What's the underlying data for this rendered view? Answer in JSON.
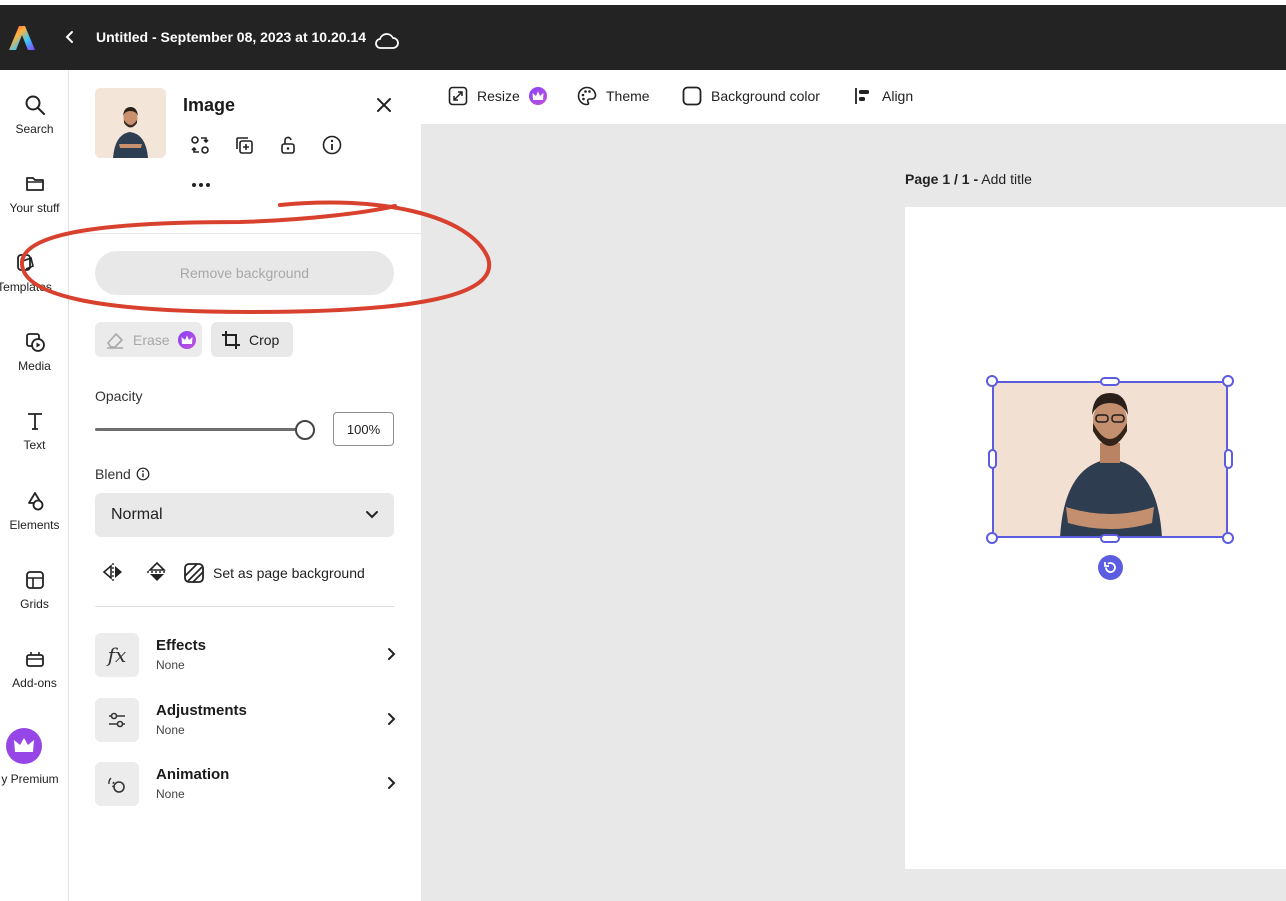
{
  "app": {
    "document_title": "Untitled - September 08, 2023 at 10.20.14",
    "logo_icon": "adobe-express-logo-icon",
    "back_icon": "chevron-left-icon",
    "cloud_icon": "cloud-icon"
  },
  "left_rail": {
    "items": [
      {
        "label": "Search",
        "icon": "search-icon"
      },
      {
        "label": "Your stuff",
        "icon": "folder-icon"
      },
      {
        "label": "Templates",
        "icon": "templates-icon"
      },
      {
        "label": "Media",
        "icon": "media-icon"
      },
      {
        "label": "Text",
        "icon": "text-icon"
      },
      {
        "label": "Elements",
        "icon": "elements-icon"
      },
      {
        "label": "Grids",
        "icon": "grids-icon"
      },
      {
        "label": "Add-ons",
        "icon": "add-ons-icon"
      },
      {
        "label": "y Premium",
        "icon": "crown-icon"
      }
    ]
  },
  "panel": {
    "title": "Image",
    "remove_background": "Remove background",
    "erase": "Erase",
    "crop": "Crop",
    "opacity_label": "Opacity",
    "opacity_value": "100%",
    "opacity_fraction": 1.0,
    "blend_label": "Blend",
    "blend_value": "Normal",
    "set_page_background": "Set as page background",
    "sections": [
      {
        "title": "Effects",
        "value": "None",
        "icon": "fx-icon"
      },
      {
        "title": "Adjustments",
        "value": "None",
        "icon": "sliders-icon"
      },
      {
        "title": "Animation",
        "value": "None",
        "icon": "animation-icon"
      }
    ]
  },
  "toolbar": {
    "resize": "Resize",
    "theme": "Theme",
    "background_color": "Background color",
    "align": "Align"
  },
  "canvas": {
    "page_label": "Page 1 / 1 -",
    "add_title": "Add title"
  },
  "colors": {
    "topbar": "#232323",
    "selection": "#5c5ce0",
    "premium": "#8a3ffc",
    "annotation": "#d9412f"
  }
}
